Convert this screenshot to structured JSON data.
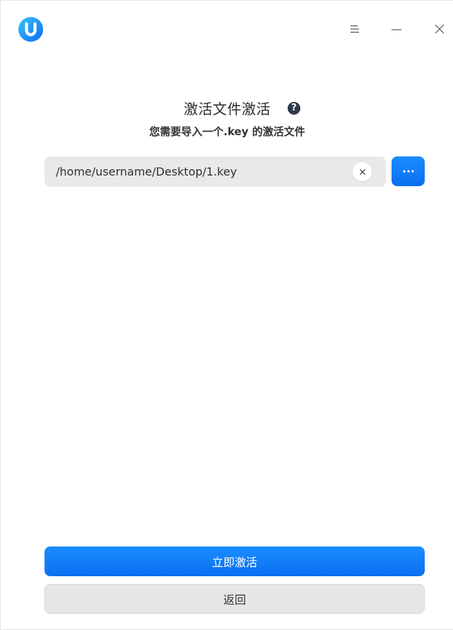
{
  "window": {
    "logo_icon": "uos-logo-icon",
    "controls": {
      "menu_icon": "menu-icon",
      "minimize_icon": "minimize-icon",
      "close_icon": "close-icon"
    }
  },
  "main": {
    "title": "激活文件激活",
    "help_glyph": "?",
    "subtitle": "您需要导入一个.key 的激活文件",
    "file_path": "/home/username/Desktop/1.key",
    "clear_icon": "clear-x-icon",
    "browse_icon": "more-dots-icon"
  },
  "footer": {
    "activate_label": "立即激活",
    "back_label": "返回"
  },
  "colors": {
    "accent": "#0a78f5",
    "field_bg": "#e9e9e9",
    "secondary_bg": "#e6e6e6",
    "help_icon_bg": "#2f3a4a"
  }
}
